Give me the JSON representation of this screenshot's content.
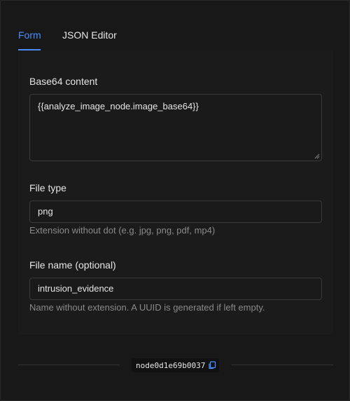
{
  "tabs": [
    {
      "label": "Form",
      "active": true
    },
    {
      "label": "JSON Editor",
      "active": false
    }
  ],
  "fields": {
    "base64": {
      "label": "Base64 content",
      "value": "{{analyze_image_node.image_base64}}"
    },
    "file_type": {
      "label": "File type",
      "value": "png",
      "hint": "Extension without dot (e.g. jpg, png, pdf, mp4)"
    },
    "file_name": {
      "label": "File name (optional)",
      "value": "intrusion_evidence",
      "hint": "Name without extension. A UUID is generated if left empty."
    }
  },
  "footer": {
    "node_id": "node0d1e69b0037",
    "copy_icon": "copy-icon"
  },
  "colors": {
    "accent": "#4a8cff",
    "background": "#181818",
    "text": "#e6e6e6",
    "muted": "#8a8a8a"
  }
}
